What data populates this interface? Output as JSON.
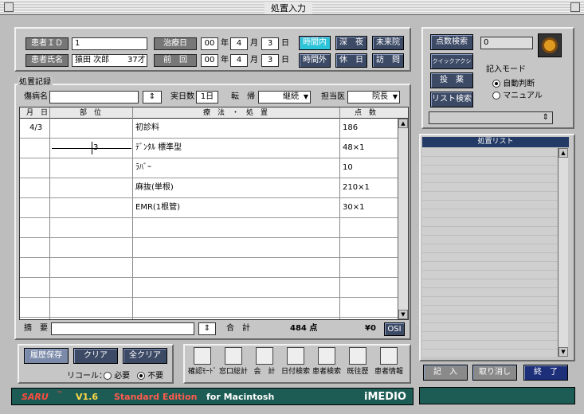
{
  "window": {
    "title": "処置入力"
  },
  "patient": {
    "id_label": "患者ＩＤ",
    "id_value": "1",
    "name_label": "患者氏名",
    "name_value": "猿田 次郎",
    "age": "37才",
    "treat_label": "治療日",
    "treat_y": "00",
    "treat_m": "4",
    "treat_d": "3",
    "prev_label": "前　回",
    "prev_y": "00",
    "prev_m": "4",
    "prev_d": "3",
    "unit_year": "年",
    "unit_month": "月",
    "unit_day": "日"
  },
  "time_buttons": [
    "時間内",
    "深　夜",
    "未来院",
    "時間外",
    "休　日",
    "訪　問"
  ],
  "record": {
    "section_label": "処置記録",
    "disease_label": "傷病名",
    "days_label": "実日数",
    "days_value": "1日",
    "outcome_label": "転　帰",
    "outcome_value": "継続",
    "doctor_label": "担当医",
    "doctor_value": "院長",
    "col_month_day": "月　日",
    "col_part": "部　位",
    "col_treatment": "療　法　・　処　置",
    "col_points": "点　数",
    "rows": [
      {
        "date": "4/3",
        "part": "",
        "treatment": "初診料",
        "points": "186"
      },
      {
        "date": "",
        "part": "3",
        "treatment": "ﾃﾞﾝﾀﾙ 標準型",
        "points": "48×1"
      },
      {
        "date": "",
        "part": "",
        "treatment": "ﾗﾊﾞｰ",
        "points": "10"
      },
      {
        "date": "",
        "part": "",
        "treatment": "麻抜(単根)",
        "points": "210×1"
      },
      {
        "date": "",
        "part": "",
        "treatment": "EMR(1根管)",
        "points": "30×1"
      }
    ],
    "summary_label": "摘　要",
    "total_label": "合　計",
    "total_points": "484 点",
    "total_yen": "¥0",
    "os_label": "OSI"
  },
  "bottom_left": {
    "history_save": "履歴保存",
    "clear": "クリア",
    "clear_all": "全クリア",
    "recall_label": "リコール：",
    "recall_needed": "必要",
    "recall_not_needed": "不要"
  },
  "icon_bar": [
    {
      "label": "確認ﾓｰﾄﾞ",
      "icon": "clipboard-icon"
    },
    {
      "label": "窓口総計",
      "icon": "pencil-icon"
    },
    {
      "label": "会　計",
      "icon": "calculator-icon"
    },
    {
      "label": "日付検索",
      "icon": "calendar-icon"
    },
    {
      "label": "患者検索",
      "icon": "patient-search-icon"
    },
    {
      "label": "既往歴",
      "icon": "history-icon"
    },
    {
      "label": "患者情報",
      "icon": "patient-info-icon"
    }
  ],
  "banner": {
    "brand": "SARU",
    "tm": "™",
    "version": "V1.6",
    "edition": "Standard Edition",
    "platform": "for Macintosh",
    "company": "iMEDIO"
  },
  "right": {
    "points_search": "点数検索",
    "quick_action": "クイックアクション",
    "injection": "投　薬",
    "list_search": "リスト検索",
    "code_value": "0",
    "mode_title": "記入モード",
    "mode_auto": "自動判断",
    "mode_manual": "マニュアル",
    "list_header": "処置リスト",
    "write_btn": "記　入",
    "cancel_btn": "取り消し",
    "end_btn": "終　了"
  },
  "colors": {
    "accent": "#2bc4d8",
    "button": "#3c4a66",
    "banner": "#1c5c54"
  }
}
